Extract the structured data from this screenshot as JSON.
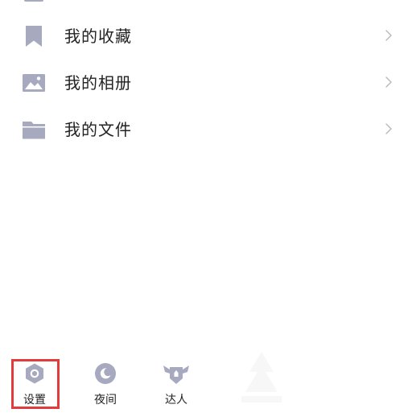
{
  "menu": {
    "items": [
      {
        "label": "我的收藏",
        "icon": "bookmark-icon"
      },
      {
        "label": "我的相册",
        "icon": "image-icon"
      },
      {
        "label": "我的文件",
        "icon": "folder-icon"
      }
    ]
  },
  "tabbar": {
    "items": [
      {
        "label": "设置",
        "icon": "settings-hexagon-icon"
      },
      {
        "label": "夜间",
        "icon": "moon-icon"
      },
      {
        "label": "达人",
        "icon": "expert-badge-icon"
      }
    ],
    "highlighted": "设置"
  },
  "colors": {
    "icon": "#a7aabf",
    "text": "#222222",
    "chevron": "#b8b8b8",
    "highlight": "#e23b3b",
    "background": "#ffffff"
  }
}
